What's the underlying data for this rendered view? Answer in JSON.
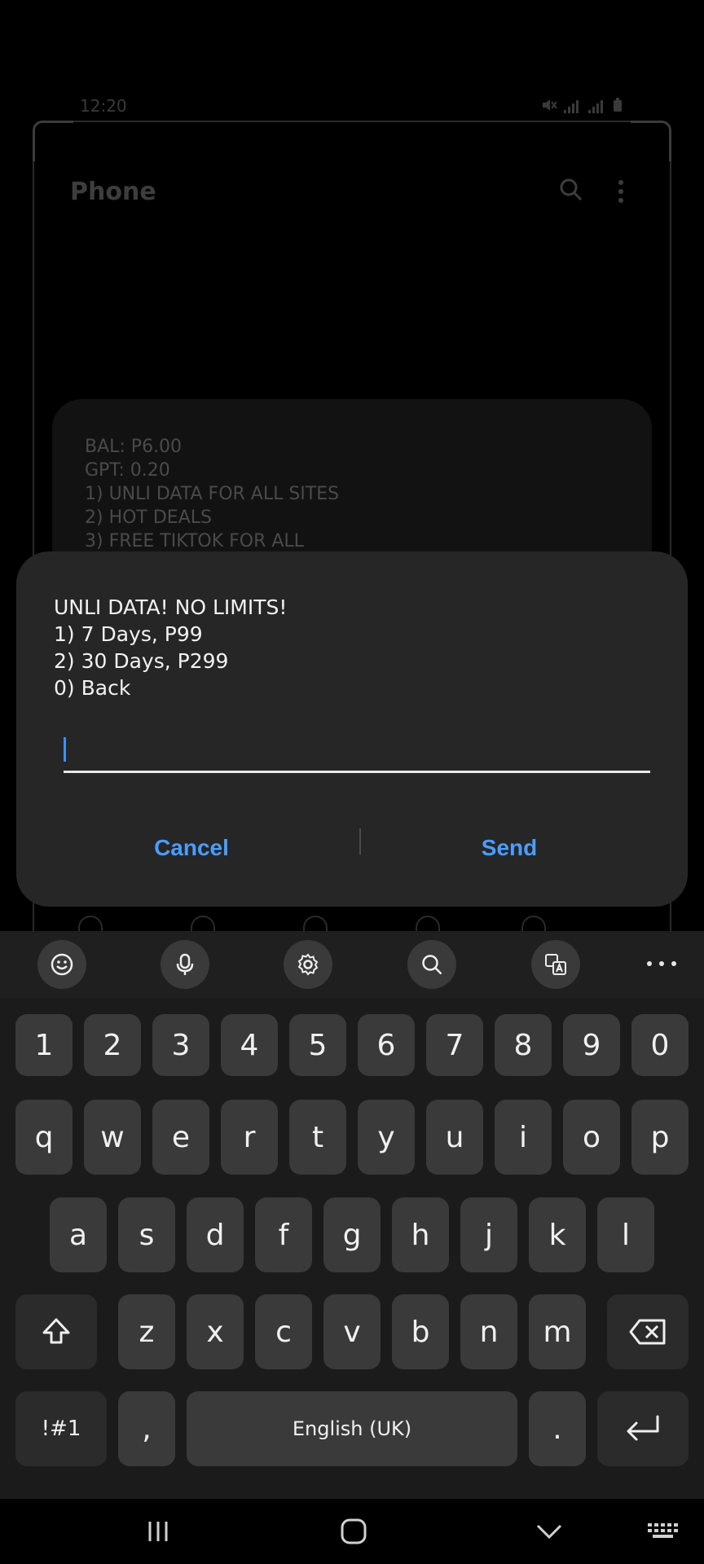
{
  "status_bar": {
    "time": "12:20"
  },
  "background_app": {
    "title": "Phone",
    "card_lines": [
      "BAL: P6.00",
      "GPT: 0.20",
      "1) UNLI DATA FOR ALL SITES",
      "2) HOT DEALS",
      "3) FREE TIKTOK FOR ALL"
    ]
  },
  "dialog": {
    "lines": [
      "UNLI DATA! NO LIMITS!",
      "1) 7 Days, P99",
      "2) 30 Days, P299",
      "0) Back"
    ],
    "input_value": "",
    "cancel_label": "Cancel",
    "send_label": "Send"
  },
  "keyboard": {
    "toolbar_icons": [
      "emoji-icon",
      "microphone-icon",
      "settings-icon",
      "search-icon",
      "translate-icon",
      "more-icon"
    ],
    "row_numbers": [
      "1",
      "2",
      "3",
      "4",
      "5",
      "6",
      "7",
      "8",
      "9",
      "0"
    ],
    "row_top": [
      "q",
      "w",
      "e",
      "r",
      "t",
      "y",
      "u",
      "i",
      "o",
      "p"
    ],
    "row_middle": [
      "a",
      "s",
      "d",
      "f",
      "g",
      "h",
      "j",
      "k",
      "l"
    ],
    "row_bottom": [
      "z",
      "x",
      "c",
      "v",
      "b",
      "n",
      "m"
    ],
    "symbols_label": "!#1",
    "comma_label": ",",
    "space_label": "English (UK)",
    "period_label": "."
  },
  "colors": {
    "accent": "#4b9cff",
    "dialog_bg": "#262626",
    "key_bg": "#3a3a3a"
  }
}
